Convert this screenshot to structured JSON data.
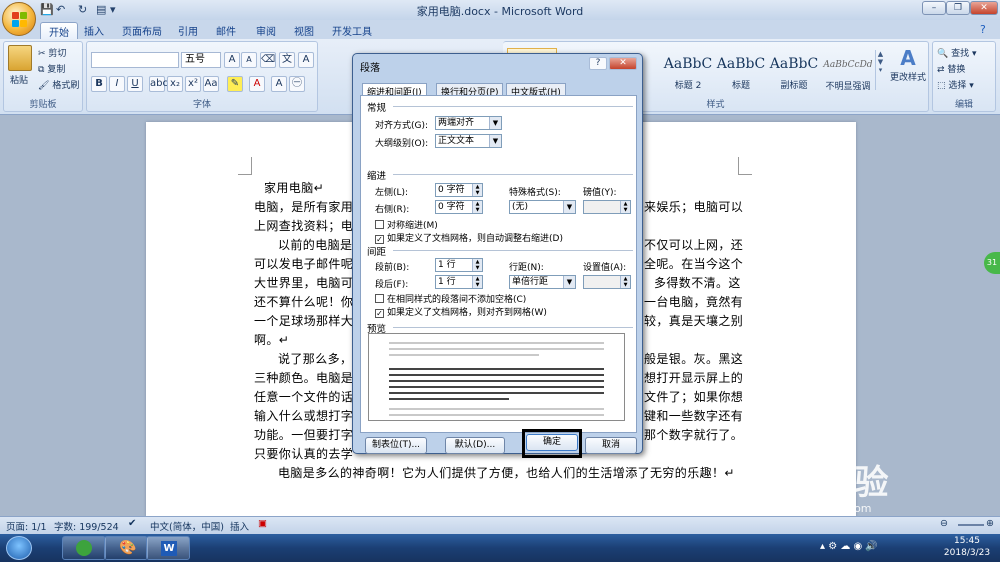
{
  "window": {
    "title": "家用电脑.docx - Microsoft Word"
  },
  "tabs": [
    "开始",
    "插入",
    "页面布局",
    "引用",
    "邮件",
    "审阅",
    "视图",
    "开发工具"
  ],
  "ribbon": {
    "clipboard": {
      "label": "剪贴板",
      "paste": "粘贴",
      "cut": "剪切",
      "copy": "复制",
      "format_painter": "格式刷"
    },
    "font": {
      "label": "字体",
      "font_size": "五号"
    },
    "styles": {
      "label": "样式",
      "items": [
        {
          "preview": "AaBbC",
          "name": "标题 2"
        },
        {
          "preview": "AaBbC",
          "name": "标题"
        },
        {
          "preview": "AaBbC",
          "name": "副标题"
        },
        {
          "preview": "AaBbCcDd",
          "name": "不明显强调"
        }
      ],
      "change_styles": "更改样式"
    },
    "editing": {
      "label": "编辑",
      "find": "查找",
      "replace": "替换",
      "select": "选择"
    }
  },
  "document": {
    "lines": [
      "家用电脑↵",
      "电脑，是所有家用",
      "上网查找资料；电",
      "以前的电脑是",
      "可以发电子邮件呢",
      "大世界里，电脑可",
      "还不算什么呢！你",
      "一个足球场那样大",
      "啊。↵",
      "说了那么多，",
      "三种颜色。电脑是",
      "任意一个文件的话",
      "输入什么或想打字",
      "功能。一但要打字",
      "只要你认真的去学",
      "电脑是多么的神奇啊！它为人们提供了方便，也给人们的生活增添了无穷的乐趣！↵"
    ],
    "right_fragments": [
      {
        "line": 1,
        "text": "来娱乐；电脑可以"
      },
      {
        "line": 3,
        "text": "不仅可以上网，还"
      },
      {
        "line": 4,
        "text": "全呢。在当今这个"
      },
      {
        "line": 5,
        "text": "多得数不清。这"
      },
      {
        "line": 6,
        "text": "一台电脑，竟然有"
      },
      {
        "line": 7,
        "text": "较，真是天壤之别"
      },
      {
        "line": 9,
        "text": "般是银。灰。黑这"
      },
      {
        "line": 10,
        "text": "想打开显示屏上的"
      },
      {
        "line": 11,
        "text": "文件了；如果你想"
      },
      {
        "line": 12,
        "text": "键和一些数字还有"
      },
      {
        "line": 13,
        "text": "那个数字就行了。"
      }
    ]
  },
  "dialog": {
    "title": "段落",
    "tabs": [
      "缩进和间距(I)",
      "换行和分页(P)",
      "中文版式(H)"
    ],
    "general": {
      "section": "常规",
      "alignment_label": "对齐方式(G):",
      "alignment_value": "两端对齐",
      "outline_label": "大纲级别(O):",
      "outline_value": "正文文本"
    },
    "indent": {
      "section": "缩进",
      "left_label": "左侧(L):",
      "left_value": "0 字符",
      "right_label": "右侧(R):",
      "right_value": "0 字符",
      "special_label": "特殊格式(S):",
      "special_value": "(无)",
      "by_label": "磅值(Y):",
      "mirror_label": "对称缩进(M)",
      "auto_adjust_label": "如果定义了文档网格，则自动调整右缩进(D)"
    },
    "spacing": {
      "section": "间距",
      "before_label": "段前(B):",
      "before_value": "1 行",
      "after_label": "段后(F):",
      "after_value": "1 行",
      "line_label": "行距(N):",
      "line_value": "单倍行距",
      "at_label": "设置值(A):",
      "no_space_label": "在相同样式的段落间不添加空格(C)",
      "snap_grid_label": "如果定义了文档网格，则对齐到网格(W)"
    },
    "preview": {
      "section": "预览"
    },
    "buttons": {
      "tabs": "制表位(T)...",
      "default": "默认(D)...",
      "ok": "确定",
      "cancel": "取消"
    }
  },
  "statusbar": {
    "page": "页面: 1/1",
    "words": "字数: 199/524",
    "language": "中文(简体，中国)",
    "mode": "插入",
    "zoom_badge": "31"
  },
  "taskbar": {
    "time": "15:45",
    "date": "2018/3/23",
    "word_icon": "W"
  },
  "watermark": {
    "text": "Bai经验",
    "url": "jingyan.baidu.com"
  }
}
